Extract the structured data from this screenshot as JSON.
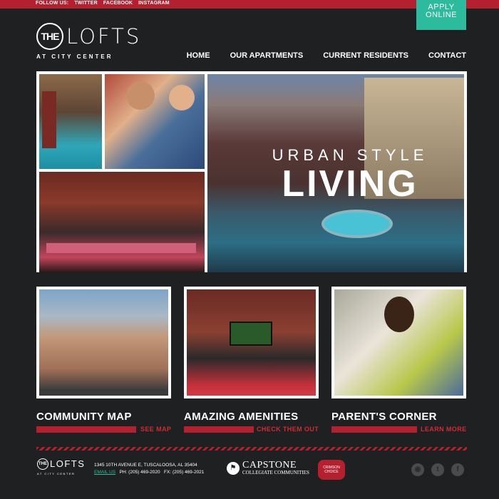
{
  "topbar": {
    "follow_label": "FOLLOW US:",
    "links": [
      "TWITTER",
      "FACEBOOK",
      "INSTAGRAM"
    ]
  },
  "apply_button": {
    "line1": "APPLY",
    "line2": "ONLINE"
  },
  "logo": {
    "circle": "THE",
    "name": "LOFTS",
    "sub": "AT CITY CENTER"
  },
  "nav": [
    "HOME",
    "OUR APARTMENTS",
    "CURRENT RESIDENTS",
    "CONTACT"
  ],
  "hero": {
    "line1": "URBAN STYLE",
    "line2": "LIVING"
  },
  "cards": [
    {
      "title": "COMMUNITY MAP",
      "link": "SEE MAP"
    },
    {
      "title": "AMAZING AMENITIES",
      "link": "CHECK THEM OUT"
    },
    {
      "title": "PARENT'S CORNER",
      "link": "LEARN MORE"
    }
  ],
  "footer": {
    "logo": {
      "circle": "THE",
      "name": "LOFTS",
      "sub": "AT CITY CENTER"
    },
    "address": "1345 10TH AVENUE E, TUSCALOOSA, AL 35404",
    "email": "EMAIL US",
    "phone": "PH: (205) 469-2020",
    "fax": "FX: (205) 469-2021",
    "capstone": {
      "line1": "CAPSTONE",
      "line2": "COLLEGIATE COMMUNITIES"
    },
    "badge": {
      "line1": "CRIMSON",
      "line2": "CHOICE"
    },
    "social_icons": [
      "instagram-icon",
      "twitter-icon",
      "facebook-icon"
    ]
  },
  "colors": {
    "accent": "#b5202e",
    "apply": "#2dbb9e",
    "background": "#1f2021"
  }
}
